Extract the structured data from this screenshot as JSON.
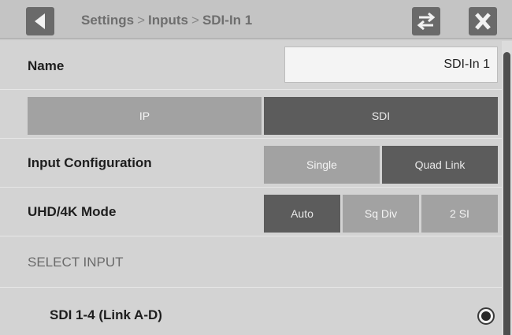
{
  "header": {
    "breadcrumb": [
      "Settings",
      "Inputs",
      "SDI-In 1"
    ],
    "separator": ">",
    "icons": {
      "back": "back-arrow-icon",
      "swap": "swap-arrows-icon",
      "close": "close-x-icon"
    }
  },
  "name": {
    "label": "Name",
    "value": "SDI-In 1"
  },
  "input_type": {
    "options": [
      "IP",
      "SDI"
    ],
    "selected": "SDI"
  },
  "input_configuration": {
    "label": "Input Configuration",
    "options": [
      "Single",
      "Quad Link"
    ],
    "selected": "Quad Link"
  },
  "uhd_mode": {
    "label": "UHD/4K Mode",
    "options": [
      "Auto",
      "Sq Div",
      "2 SI"
    ],
    "selected": "Auto"
  },
  "select_input": {
    "heading": "SELECT INPUT",
    "items": [
      {
        "label": "SDI 1-4 (Link A-D)",
        "selected": true
      }
    ]
  },
  "colors": {
    "selected": "#5c5c5c",
    "unselected": "#a2a2a2",
    "background": "#d3d3d3",
    "titlebar": "#c4c4c4"
  }
}
